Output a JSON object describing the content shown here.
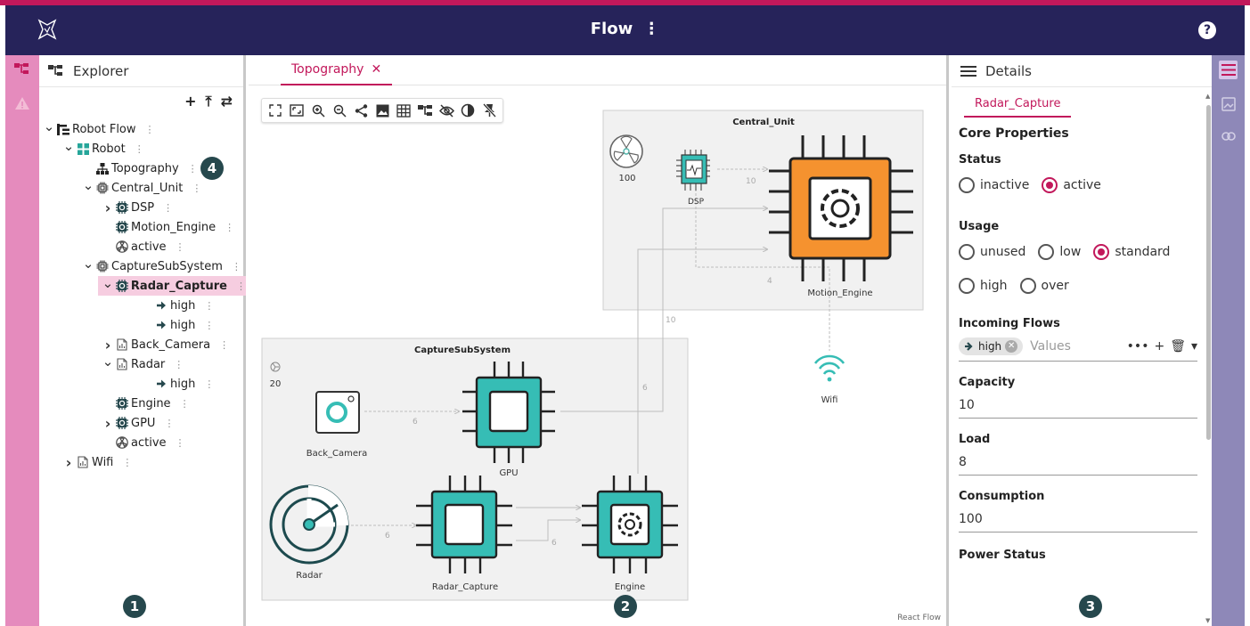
{
  "app": {
    "title": "Flow",
    "menu_glyph": "⋮",
    "help_glyph": "?"
  },
  "colors": {
    "accent": "#c2185b",
    "titlebar": "#26235a",
    "left_rail": "#e58bbd",
    "right_rail": "#8e88b8",
    "node_teal": "#36bdb5",
    "node_orange": "#f5922f",
    "selection": "#f6cde0",
    "badge": "#26484d"
  },
  "explorer": {
    "title": "Explorer",
    "tools": [
      "+",
      "⤒",
      "⇄"
    ],
    "tree": [
      {
        "label": "Robot Flow",
        "depth": 0,
        "chevron": "down",
        "icon": "hierarchy-icon"
      },
      {
        "label": "Robot",
        "depth": 1,
        "chevron": "down",
        "icon": "grid-icon"
      },
      {
        "label": "Topography",
        "depth": 2,
        "chevron": "",
        "icon": "sitemap-icon"
      },
      {
        "label": "Central_Unit",
        "depth": 2,
        "chevron": "down",
        "icon": "chip-outline-icon"
      },
      {
        "label": "DSP",
        "depth": 3,
        "chevron": "right",
        "icon": "chip-gear-icon"
      },
      {
        "label": "Motion_Engine",
        "depth": 3,
        "chevron": "",
        "icon": "chip-gear-icon"
      },
      {
        "label": "active",
        "depth": 3,
        "chevron": "",
        "icon": "fan-icon"
      },
      {
        "label": "CaptureSubSystem",
        "depth": 2,
        "chevron": "down",
        "icon": "chip-outline-icon"
      },
      {
        "label": "Radar_Capture",
        "depth": 3,
        "chevron": "down",
        "icon": "chip-gear-icon",
        "selected": true
      },
      {
        "label": "high",
        "depth": 5,
        "chevron": "",
        "icon": "arrow-right-icon"
      },
      {
        "label": "high",
        "depth": 5,
        "chevron": "",
        "icon": "arrow-right-icon"
      },
      {
        "label": "Back_Camera",
        "depth": 3,
        "chevron": "right",
        "icon": "file-chart-icon"
      },
      {
        "label": "Radar",
        "depth": 3,
        "chevron": "down",
        "icon": "file-chart-icon"
      },
      {
        "label": "high",
        "depth": 5,
        "chevron": "",
        "icon": "arrow-right-icon"
      },
      {
        "label": "Engine",
        "depth": 3,
        "chevron": "",
        "icon": "chip-gear-icon"
      },
      {
        "label": "GPU",
        "depth": 3,
        "chevron": "right",
        "icon": "chip-gear-icon"
      },
      {
        "label": "active",
        "depth": 3,
        "chevron": "",
        "icon": "fan-icon"
      },
      {
        "label": "Wifi",
        "depth": 1,
        "chevron": "right",
        "icon": "file-chart-icon"
      }
    ]
  },
  "center": {
    "tab": {
      "label": "Topography",
      "close_glyph": "✕"
    },
    "toolbar_icons": [
      "fit-view-icon",
      "fullscreen-icon",
      "zoom-in-icon",
      "zoom-out-icon",
      "share-icon",
      "image-icon",
      "grid-icon",
      "hierarchy-icon",
      "eye-off-icon",
      "contrast-icon",
      "pin-off-icon"
    ],
    "attribution": "React Flow",
    "diagram": {
      "groups": [
        {
          "id": "central",
          "label": "Central_Unit"
        },
        {
          "id": "capture",
          "label": "CaptureSubSystem"
        }
      ],
      "nodes": [
        {
          "id": "fan1",
          "label": "",
          "value": "100"
        },
        {
          "id": "dsp",
          "label": "DSP"
        },
        {
          "id": "motion",
          "label": "Motion_Engine"
        },
        {
          "id": "wifi",
          "label": "Wifi"
        },
        {
          "id": "fan2",
          "label": "",
          "value": "20"
        },
        {
          "id": "camera",
          "label": "Back_Camera"
        },
        {
          "id": "gpu",
          "label": "GPU"
        },
        {
          "id": "radar",
          "label": "Radar"
        },
        {
          "id": "radarcap",
          "label": "Radar_Capture"
        },
        {
          "id": "engine",
          "label": "Engine"
        }
      ],
      "edges": [
        {
          "id": "dsp-motion",
          "label": "10"
        },
        {
          "id": "dsp-engine",
          "label": "4"
        },
        {
          "id": "gpu-motion",
          "label": "10"
        },
        {
          "id": "engine-motion",
          "label": "6"
        },
        {
          "id": "camera-gpu",
          "label": "6"
        },
        {
          "id": "radar-radarcap",
          "label": "6"
        },
        {
          "id": "radarcap-engine",
          "label": "6"
        }
      ]
    }
  },
  "details": {
    "title": "Details",
    "tab": "Radar_Capture",
    "section": "Core Properties",
    "status": {
      "label": "Status",
      "options": [
        "inactive",
        "active"
      ],
      "selected": "active"
    },
    "usage": {
      "label": "Usage",
      "options": [
        "unused",
        "low",
        "standard",
        "high",
        "over"
      ],
      "selected": "standard"
    },
    "incoming": {
      "label": "Incoming Flows",
      "chip": "high",
      "placeholder": "Values",
      "tools": [
        "•••",
        "+",
        "🗑",
        "▾"
      ]
    },
    "capacity": {
      "label": "Capacity",
      "value": "10"
    },
    "load": {
      "label": "Load",
      "value": "8"
    },
    "consumption": {
      "label": "Consumption",
      "value": "100"
    },
    "power_status": {
      "label": "Power Status"
    }
  },
  "badges": [
    "1",
    "2",
    "3",
    "4"
  ]
}
